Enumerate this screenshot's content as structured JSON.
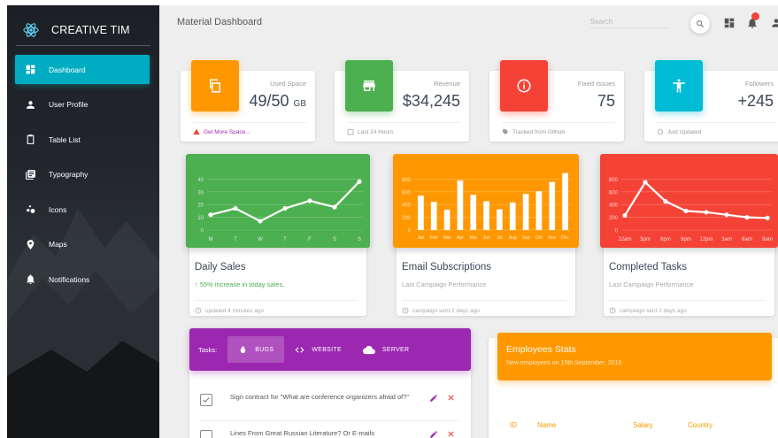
{
  "brand": {
    "name": "CREATIVE TIM"
  },
  "sidebar": {
    "items": [
      {
        "label": "Dashboard",
        "icon": "dashboard-icon",
        "active": true
      },
      {
        "label": "User Profile",
        "icon": "person-icon",
        "active": false
      },
      {
        "label": "Table List",
        "icon": "clipboard-icon",
        "active": false
      },
      {
        "label": "Typography",
        "icon": "library-books-icon",
        "active": false
      },
      {
        "label": "Icons",
        "icon": "bubble-chart-icon",
        "active": false
      },
      {
        "label": "Maps",
        "icon": "location-pin-icon",
        "active": false
      },
      {
        "label": "Notifications",
        "icon": "bell-icon",
        "active": false
      }
    ]
  },
  "header": {
    "title": "Material Dashboard",
    "search_placeholder": "Search"
  },
  "stats": [
    {
      "label": "Used Space",
      "value": "49/50",
      "unit": "GB",
      "footer": "Get More Space...",
      "color": "#ff9800",
      "icon": "content-copy-icon",
      "footer_icon": "warning-icon"
    },
    {
      "label": "Revenue",
      "value": "$34,245",
      "unit": "",
      "footer": "Last 24 Hours",
      "color": "#4caf50",
      "icon": "store-icon",
      "footer_icon": "calendar-icon"
    },
    {
      "label": "Fixed Issues",
      "value": "75",
      "unit": "",
      "footer": "Tracked from Github",
      "color": "#f44336",
      "icon": "info-outline-icon",
      "footer_icon": "tag-icon"
    },
    {
      "label": "Followers",
      "value": "+245",
      "unit": "",
      "footer": "Just Updated",
      "color": "#00bcd4",
      "icon": "accessibility-icon",
      "footer_icon": "update-icon"
    }
  ],
  "charts": [
    {
      "title": "Daily Sales",
      "category": "↑ 55% increase in today sales.",
      "footer": "updated 4 minutes ago",
      "color": "#4caf50"
    },
    {
      "title": "Email Subscriptions",
      "category": "Last Campaign Performance",
      "footer": "campaign sent 2 days ago",
      "color": "#ff9800"
    },
    {
      "title": "Completed Tasks",
      "category": "Last Campaign Performance",
      "footer": "campaign sent 2 days ago",
      "color": "#f44336"
    }
  ],
  "chart_data": [
    {
      "type": "line",
      "categories": [
        "M",
        "T",
        "W",
        "T",
        "F",
        "S",
        "S"
      ],
      "values": [
        12,
        17,
        7,
        17,
        23,
        18,
        38
      ],
      "ylim": [
        0,
        50
      ],
      "yticks": [
        "0",
        "10",
        "20",
        "30",
        "40"
      ],
      "grid": true
    },
    {
      "type": "bar",
      "categories": [
        "Jan",
        "Feb",
        "Mar",
        "Apr",
        "Mai",
        "Jun",
        "Jul",
        "Aug",
        "Sep",
        "Oct",
        "Nov",
        "Dec"
      ],
      "values": [
        542,
        443,
        320,
        780,
        553,
        453,
        326,
        434,
        568,
        610,
        756,
        895
      ],
      "ylim": [
        0,
        1000
      ],
      "yticks": [
        "0",
        "200",
        "400",
        "600",
        "800"
      ],
      "grid": true
    },
    {
      "type": "line",
      "categories": [
        "12am",
        "3pm",
        "6pm",
        "9pm",
        "12pm",
        "3am",
        "6am",
        "9am"
      ],
      "values": [
        230,
        750,
        450,
        300,
        280,
        240,
        200,
        190
      ],
      "ylim": [
        0,
        1000
      ],
      "yticks": [
        "0",
        "200",
        "400",
        "600",
        "800"
      ],
      "grid": true
    }
  ],
  "tasks": {
    "label": "Tasks:",
    "tabs": [
      {
        "label": "BUGS",
        "icon": "bug-icon",
        "active": true
      },
      {
        "label": "WEBSITE",
        "icon": "code-icon",
        "active": false
      },
      {
        "label": "SERVER",
        "icon": "cloud-icon",
        "active": false
      }
    ],
    "items": [
      {
        "text": "Sign contract for \"What are conference organizers afraid of?\"",
        "checked": true
      },
      {
        "text": "Lines From Great Russian Literature? Or E-mails",
        "checked": false
      }
    ]
  },
  "employees": {
    "title": "Employees Stats",
    "subtitle": "New employees on 15th September, 2016",
    "columns": [
      "ID",
      "Name",
      "Salary",
      "Country"
    ]
  }
}
